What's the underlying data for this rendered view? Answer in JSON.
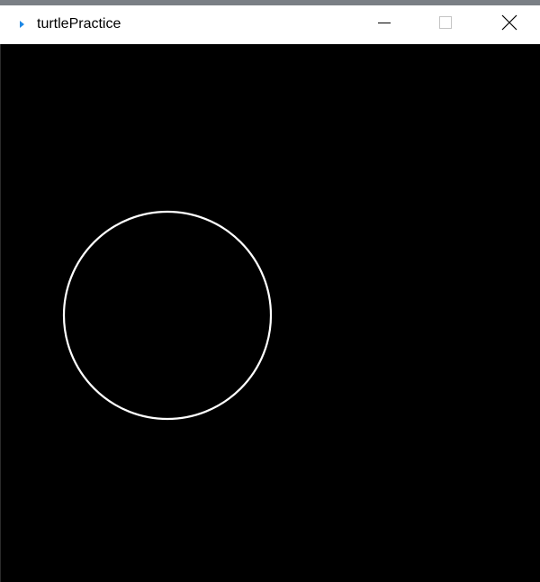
{
  "window": {
    "title": "turtlePractice",
    "icons": {
      "app": "turtle-arrow-icon",
      "minimize": "minimize-icon",
      "maximize": "maximize-icon",
      "close": "close-icon"
    },
    "colors": {
      "titlebar": "#ffffff",
      "icon_accent": "#1e88e5"
    }
  },
  "canvas": {
    "background": "#000000",
    "shapes": [
      {
        "type": "circle",
        "stroke": "#ffffff"
      }
    ]
  }
}
